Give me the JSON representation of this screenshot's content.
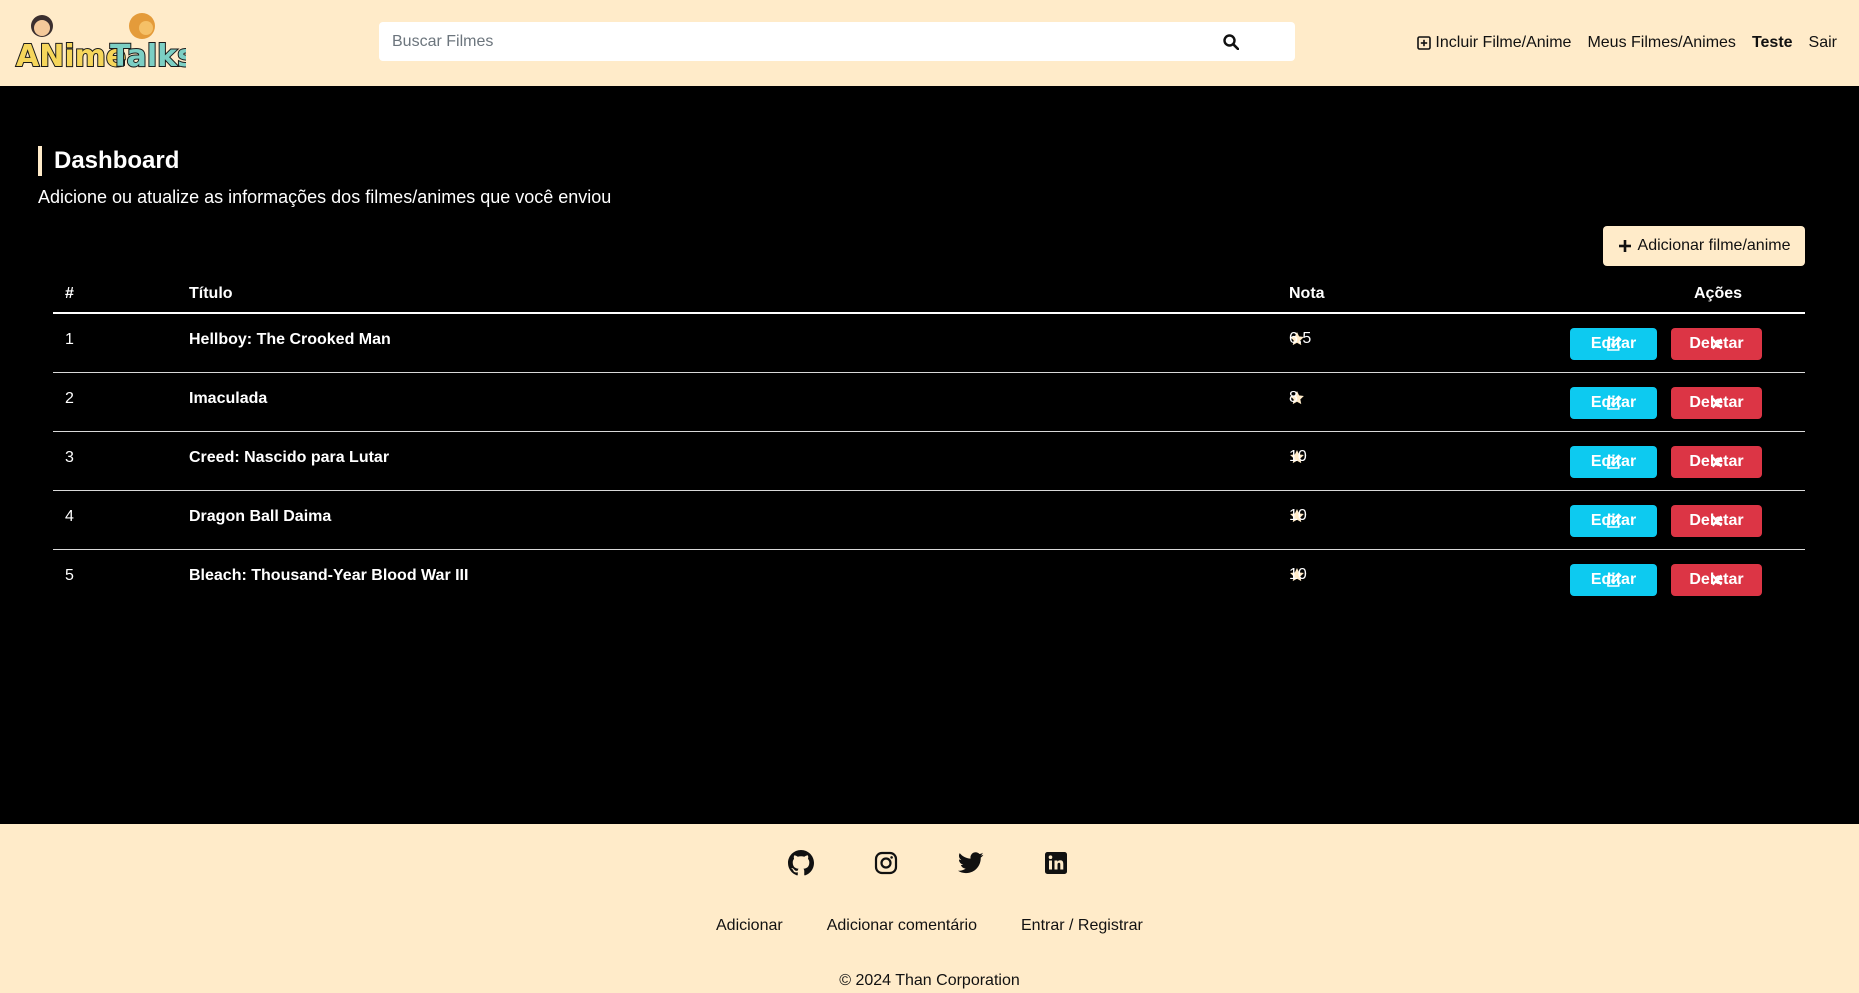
{
  "brand": {
    "logo_text": "AnimeTalks"
  },
  "search": {
    "placeholder": "Buscar Filmes",
    "icon": "search-icon"
  },
  "nav": {
    "include_label": "Incluir Filme/Anime",
    "include_icon": "plus-square-icon",
    "my_label": "Meus Filmes/Animes",
    "user_label": "Teste",
    "logout_label": "Sair"
  },
  "dashboard": {
    "title": "Dashboard",
    "subtitle": "Adicione ou atualize as informações dos filmes/animes que você enviou",
    "add_button": "Adicionar filme/anime"
  },
  "table": {
    "headers": {
      "num": "#",
      "title": "Título",
      "nota": "Nota",
      "acoes": "Ações"
    },
    "rows": [
      {
        "num": "1",
        "title": "Hellboy: The Crooked Man",
        "nota": "6.5"
      },
      {
        "num": "2",
        "title": "Imaculada",
        "nota": "8"
      },
      {
        "num": "3",
        "title": "Creed: Nascido para Lutar",
        "nota": "10"
      },
      {
        "num": "4",
        "title": "Dragon Ball Daima",
        "nota": "10"
      },
      {
        "num": "5",
        "title": "Bleach: Thousand-Year Blood War III",
        "nota": "10"
      }
    ],
    "edit_label": "Editar",
    "delete_label": "Deletar"
  },
  "footer": {
    "socials": [
      "github-icon",
      "instagram-icon",
      "twitter-icon",
      "linkedin-icon"
    ],
    "links": {
      "add": "Adicionar",
      "comment": "Adicionar comentário",
      "login": "Entrar / Registrar"
    },
    "copyright": "© 2024 Than Corporation"
  },
  "colors": {
    "cream": "#ffebc9",
    "edit": "#0dcaf0",
    "delete": "#dc3545",
    "background": "#000000"
  }
}
